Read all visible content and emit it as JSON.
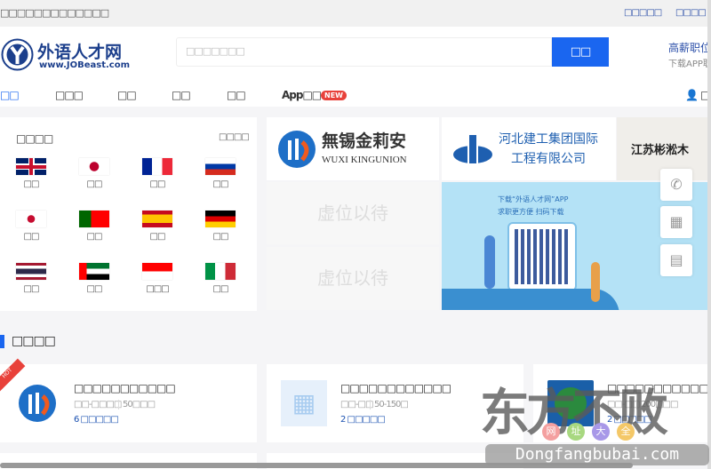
{
  "topbar": {
    "welcome": "□□□□□□□□□□□□□",
    "links": [
      "□□□□□",
      "□□□□"
    ]
  },
  "logo": {
    "name": "外语人才网",
    "url": "www.JOBeast.com"
  },
  "search": {
    "placeholder": "□□□□□□□",
    "button": "□□"
  },
  "promo": {
    "title": "高薪职位",
    "subtitle": "下载APP职"
  },
  "nav": {
    "items": [
      "□□",
      "□□□",
      "□□",
      "□□",
      "□□",
      "App□□"
    ],
    "badge": "NEW",
    "user": "□"
  },
  "languages": {
    "title": "□□□□",
    "more": "□□□□",
    "items": [
      {
        "flag": "uk",
        "label": "□□"
      },
      {
        "flag": "japan",
        "label": "□□"
      },
      {
        "flag": "france",
        "label": "□□"
      },
      {
        "flag": "russia",
        "label": "□□"
      },
      {
        "flag": "korea",
        "label": "□□"
      },
      {
        "flag": "portugal",
        "label": "□□"
      },
      {
        "flag": "spain",
        "label": "□□"
      },
      {
        "flag": "germany",
        "label": "□□"
      },
      {
        "flag": "thailand",
        "label": "□□"
      },
      {
        "flag": "uae",
        "label": "□□"
      },
      {
        "flag": "indonesia",
        "label": "□□□"
      },
      {
        "flag": "italy",
        "label": "□□"
      }
    ]
  },
  "ads": {
    "wuxi_cn": "無锡金莉安",
    "wuxi_en": "WUXI KINGUNION",
    "hebei_1": "河北建工集团国际",
    "hebei_2": "工程有限公司",
    "jiangsu": "江苏彬淞木",
    "placeholder": "虚位以待",
    "banner_1": "下载“外语人才网”APP",
    "banner_2": "求职更方便  扫码下载"
  },
  "section": {
    "title": "□□□□"
  },
  "companies": [
    {
      "name": "□□□□□□□□□□□",
      "meta1": "□□-□□□□",
      "meta2": "50□□□",
      "jobs": "6 □□□□□",
      "hot": "HOT"
    },
    {
      "name": "□□□□□□□□□□□□",
      "meta1": "□□-□□",
      "meta2": "50-150□",
      "jobs": "2 □□□□□"
    },
    {
      "name": "□□□□□□□□□□□□□□□□",
      "meta1": "□□-□□",
      "meta2": "200□□□",
      "jobs": "2 □□□□□"
    }
  ],
  "watermark": {
    "big": "东方不败",
    "small": [
      "网",
      "址",
      "大",
      "全"
    ],
    "url": "Dongfangbubai.com"
  },
  "colors": {
    "accent": "#1a66f0",
    "badge": "#e8413a"
  }
}
